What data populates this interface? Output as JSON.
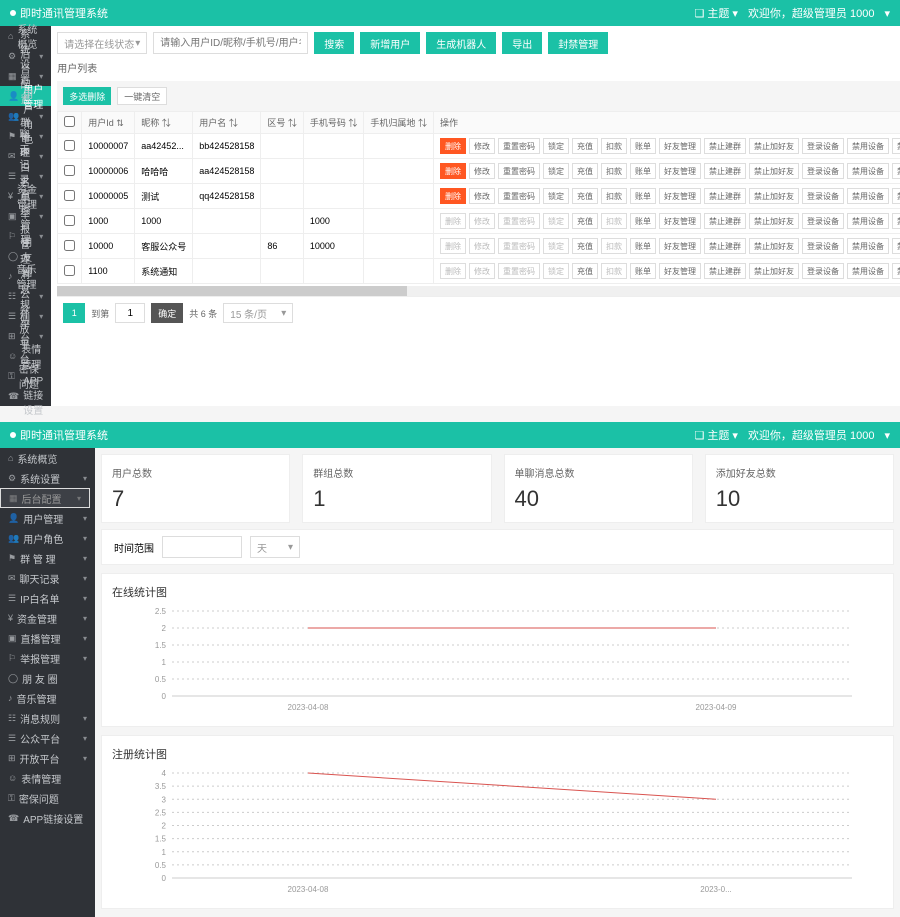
{
  "brand": "即时通讯管理系统",
  "header": {
    "theme": "主题",
    "greeting": "欢迎你，超级管理员 1000",
    "caret": "▾"
  },
  "sidebar": {
    "items": [
      {
        "icon": "⌂",
        "label": "系统概览",
        "caret": false
      },
      {
        "icon": "⚙",
        "label": "系统设置",
        "caret": true
      },
      {
        "icon": "▦",
        "label": "后台配置",
        "caret": true
      },
      {
        "icon": "👤",
        "label": "用户管理",
        "caret": false,
        "active": true
      },
      {
        "icon": "👥",
        "label": "用户角色",
        "caret": true
      },
      {
        "icon": "⚑",
        "label": "群 管 理",
        "caret": true
      },
      {
        "icon": "✉",
        "label": "聊天记录",
        "caret": true
      },
      {
        "icon": "☰",
        "label": "IP白名单",
        "caret": true
      },
      {
        "icon": "¥",
        "label": "资金管理",
        "caret": true
      },
      {
        "icon": "▣",
        "label": "直播管理",
        "caret": true
      },
      {
        "icon": "⚐",
        "label": "举报管理",
        "caret": true
      },
      {
        "icon": "◯",
        "label": "朋 友 圈",
        "caret": false
      },
      {
        "icon": "♪",
        "label": "音乐管理",
        "caret": false
      },
      {
        "icon": "☷",
        "label": "消息规则",
        "caret": true
      },
      {
        "icon": "☰",
        "label": "公众平台",
        "caret": true
      },
      {
        "icon": "⊞",
        "label": "开放平台",
        "caret": true
      },
      {
        "icon": "☺",
        "label": "表情管理",
        "caret": false
      },
      {
        "icon": "⚿",
        "label": "密保问题",
        "caret": false
      },
      {
        "icon": "☎",
        "label": "APP链接设置",
        "caret": false
      }
    ]
  },
  "top": {
    "filters": {
      "status_placeholder": "请选择在线状态",
      "search_placeholder": "请输入用户ID/昵称/手机号/用户名"
    },
    "buttons": {
      "search": "搜索",
      "new": "新增用户",
      "robot": "生成机器人",
      "export": "导出",
      "ban": "封禁管理"
    },
    "list_title": "用户列表",
    "tb_buttons": {
      "multi_del": "多选删除",
      "clear": "一键清空"
    },
    "columns": {
      "id": "用户Id",
      "nick": "昵称",
      "name": "用户名",
      "area": "区号",
      "phone": "手机号码",
      "loc": "手机归属地",
      "op": "操作"
    },
    "op": {
      "del": "删除",
      "mod": "修改",
      "pwd": "重置密码",
      "lock": "锁定",
      "recharge": "充值",
      "deduct": "扣款",
      "bill": "账单",
      "friend": "好友管理",
      "nogroup": "禁止建群",
      "noadd": "禁止加好友",
      "device": "登录设备",
      "disable": "禁用设备",
      "banip": "禁用IP"
    },
    "rows": [
      {
        "id": "10000007",
        "nick": "aa42452...",
        "name": "bb424528158",
        "area": "",
        "phone": "",
        "loc": "",
        "del": true,
        "mod": true,
        "lock": true
      },
      {
        "id": "10000006",
        "nick": "哈哈哈",
        "name": "aa424528158",
        "area": "",
        "phone": "",
        "loc": "",
        "del": true,
        "mod": true,
        "lock": true
      },
      {
        "id": "10000005",
        "nick": "测试",
        "name": "qq424528158",
        "area": "",
        "phone": "",
        "loc": "",
        "del": true,
        "mod": true,
        "lock": true
      },
      {
        "id": "1000",
        "nick": "1000",
        "name": "",
        "area": "",
        "phone": "1000",
        "loc": "",
        "del": false,
        "mod": false,
        "lock": false
      },
      {
        "id": "10000",
        "nick": "客服公众号",
        "name": "",
        "area": "86",
        "phone": "10000",
        "loc": "",
        "del": false,
        "mod": false,
        "lock": false
      },
      {
        "id": "1100",
        "nick": "系统通知",
        "name": "",
        "area": "",
        "phone": "",
        "loc": "",
        "del": false,
        "mod": false,
        "lock": false
      }
    ],
    "pager": {
      "page": "1",
      "goto": "到第",
      "confirm": "确定",
      "total": "共 6 条",
      "per": "15 条/页"
    }
  },
  "dash": {
    "sidebar_items": [
      {
        "icon": "⌂",
        "label": "系统概览"
      },
      {
        "icon": "⚙",
        "label": "系统设置",
        "caret": true
      },
      {
        "icon": "▦",
        "label": "后台配置",
        "caret": true,
        "sel": true
      },
      {
        "icon": "👤",
        "label": "用户管理",
        "caret": true
      },
      {
        "icon": "👥",
        "label": "用户角色",
        "caret": true
      },
      {
        "icon": "⚑",
        "label": "群 管 理",
        "caret": true
      },
      {
        "icon": "✉",
        "label": "聊天记录",
        "caret": true
      },
      {
        "icon": "☰",
        "label": "IP白名单",
        "caret": true
      },
      {
        "icon": "¥",
        "label": "资金管理",
        "caret": true
      },
      {
        "icon": "▣",
        "label": "直播管理",
        "caret": true
      },
      {
        "icon": "⚐",
        "label": "举报管理",
        "caret": true
      },
      {
        "icon": "◯",
        "label": "朋 友 圈"
      },
      {
        "icon": "♪",
        "label": "音乐管理"
      },
      {
        "icon": "☷",
        "label": "消息规则",
        "caret": true
      },
      {
        "icon": "☰",
        "label": "公众平台",
        "caret": true
      },
      {
        "icon": "⊞",
        "label": "开放平台",
        "caret": true
      },
      {
        "icon": "☺",
        "label": "表情管理"
      },
      {
        "icon": "⚿",
        "label": "密保问题"
      },
      {
        "icon": "☎",
        "label": "APP链接设置"
      }
    ],
    "cards": [
      {
        "t": "用户总数",
        "v": "7"
      },
      {
        "t": "群组总数",
        "v": "1"
      },
      {
        "t": "单聊消息总数",
        "v": "40"
      },
      {
        "t": "添加好友总数",
        "v": "10"
      }
    ],
    "time_label": "时间范围",
    "time_unit": "天",
    "chart1_title": "在线统计图",
    "chart2_title": "注册统计图"
  },
  "chart_data": [
    {
      "type": "line",
      "title": "在线统计图",
      "x": [
        "2023-04-08",
        "2023-04-09"
      ],
      "values": [
        2,
        2
      ],
      "ylim": [
        0,
        2.5
      ],
      "yticks": [
        0,
        0.5,
        1,
        1.5,
        2,
        2.5
      ]
    },
    {
      "type": "line",
      "title": "注册统计图",
      "x": [
        "2023-04-08",
        "2023-0..."
      ],
      "values": [
        4,
        3
      ],
      "ylim": [
        0,
        4
      ],
      "yticks": [
        0,
        0.5,
        1,
        1.5,
        2,
        2.5,
        3,
        3.5,
        4
      ]
    }
  ]
}
